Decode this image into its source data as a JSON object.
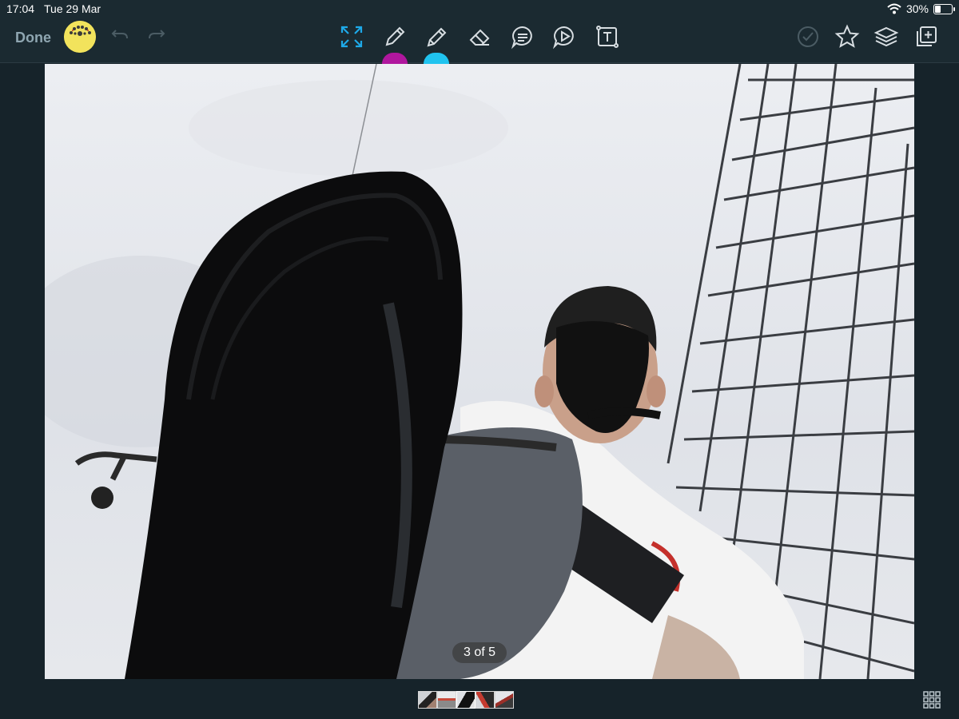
{
  "status": {
    "time": "17:04",
    "date": "Tue 29 Mar",
    "battery": "30%",
    "battery_level": 0.3
  },
  "toolbar": {
    "done_label": "Done",
    "icons": {
      "undo": "undo-icon",
      "redo": "redo-icon",
      "fullscreen": "expand-icon",
      "pen": "pencil-icon",
      "highlighter": "highlighter-icon",
      "eraser": "eraser-icon",
      "comment": "speech-bubble-icon",
      "play": "play-icon",
      "text": "text-box-icon",
      "check": "checkmark-circle-icon",
      "favorite": "star-icon",
      "layers": "layers-icon",
      "add": "add-square-icon"
    },
    "pen_color": "#b0179e",
    "highlighter_color": "#20c3ef",
    "accent_color": "#1ea9e8"
  },
  "viewer": {
    "page_counter": "3 of 5",
    "thumbnail_count": 5,
    "current_index": 3
  }
}
